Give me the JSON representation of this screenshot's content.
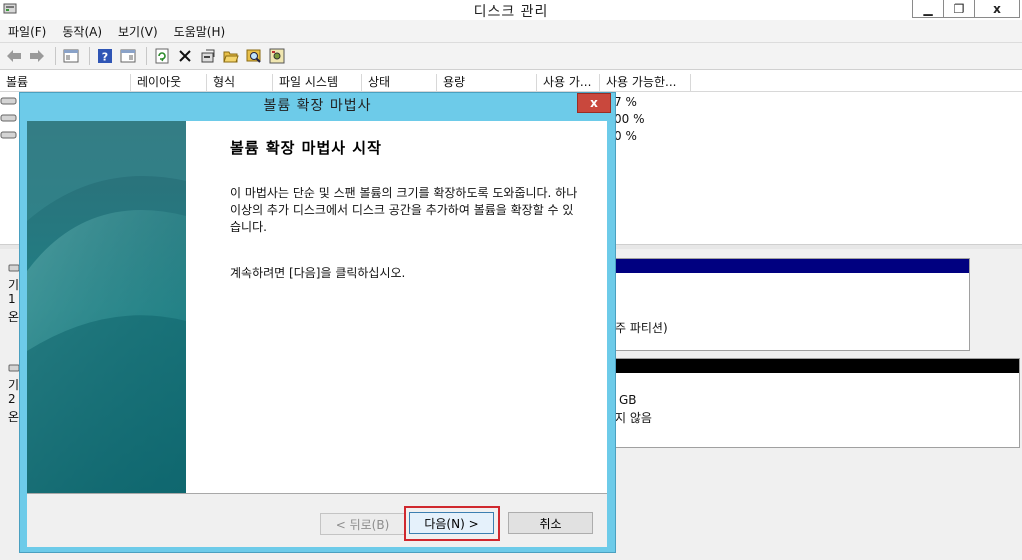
{
  "window": {
    "title": "디스크 관리",
    "minimize": "▁",
    "restore": "❐",
    "close": "x"
  },
  "menu": [
    "파일(F)",
    "동작(A)",
    "보기(V)",
    "도움말(H)"
  ],
  "toolbar_icons": [
    "back-arrow-icon",
    "forward-arrow-icon",
    "console-tree-icon",
    "help-icon",
    "show-pane-icon",
    "refresh-icon",
    "delete-icon",
    "properties-icon",
    "open-icon",
    "explore-icon",
    "settings-icon"
  ],
  "columns": [
    "볼륨",
    "레이아웃",
    "형식",
    "파일 시스템",
    "상태",
    "용량",
    "사용 가...",
    "사용 가능한..."
  ],
  "volume_pct": [
    "7 %",
    "00 %",
    "0 %"
  ],
  "disk1": {
    "partition": "주 파티션)",
    "left_frag": [
      "디",
      "기",
      "1",
      "온"
    ]
  },
  "disk2": {
    "size": "GB",
    "status": "지 않음",
    "left_frag": [
      "디",
      "기",
      "2",
      "온"
    ]
  },
  "dialog": {
    "title": "볼륨 확장 마법사",
    "close": "x",
    "heading": "볼륨 확장 마법사 시작",
    "description": "이 마법사는 단순 및 스팬 볼륨의 크기를 확장하도록 도와줍니다. 하나 이상의 추가 디스크에서 디스크 공간을 추가하여 볼륨을 확장할 수 있습니다.",
    "continue_text": "계속하려면 [다음]을 클릭하십시오.",
    "back": "< 뒤로(B)",
    "next": "다음(N) >",
    "cancel": "취소"
  },
  "colors": {
    "dialog_frame": "#6dcbe9",
    "close_red": "#c9483d",
    "stripe_blue": "#000080",
    "highlight": "#d0282e",
    "banner_teal": "#1f7f84"
  }
}
